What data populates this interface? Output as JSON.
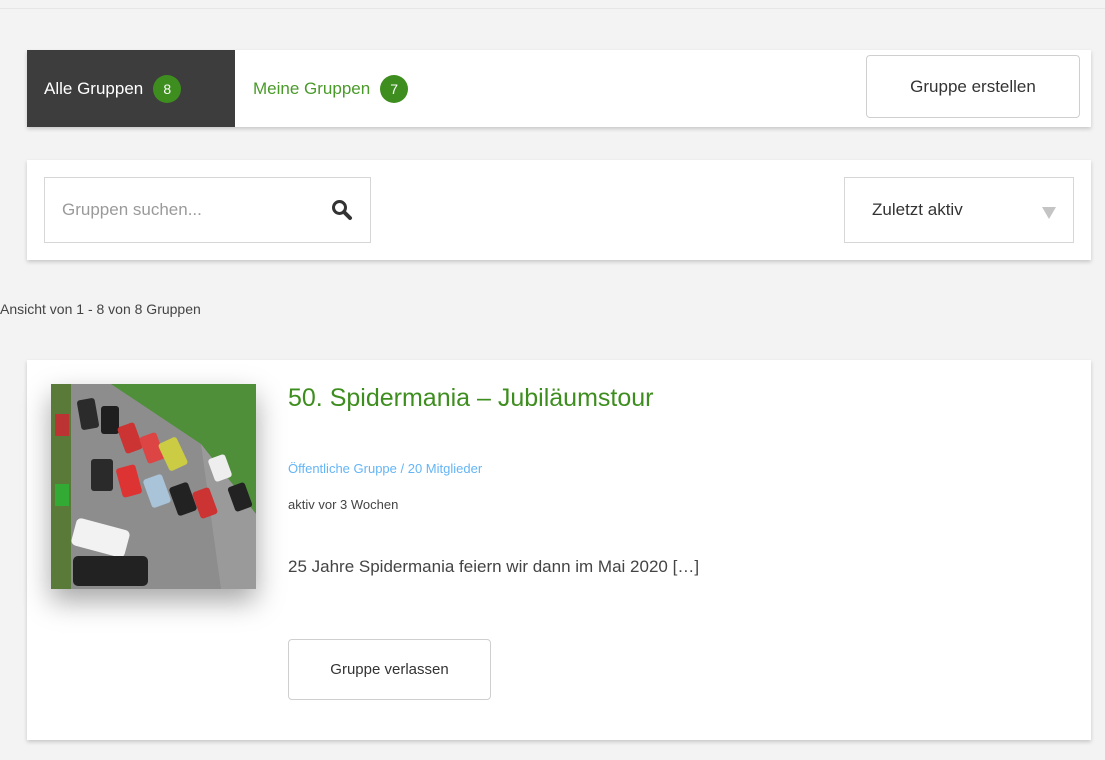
{
  "tabs": {
    "all": {
      "label": "Alle Gruppen",
      "count": "8"
    },
    "mine": {
      "label": "Meine Gruppen",
      "count": "7"
    }
  },
  "actions": {
    "create_group": "Gruppe erstellen"
  },
  "filter": {
    "search_placeholder": "Gruppen suchen...",
    "sort_selected": "Zuletzt aktiv"
  },
  "summary": "Ansicht von 1 - 8 von 8 Gruppen",
  "groups": [
    {
      "title": "50. Spidermania – Jubiläumstour",
      "meta": "Öffentliche Gruppe / 20 Mitglieder",
      "active": "aktiv vor 3 Wochen",
      "description": "25 Jahre Spidermania feiern wir dann im Mai 2020 […]",
      "button": "Gruppe verlassen"
    }
  ],
  "colors": {
    "accent": "#3e8e1f",
    "dark_tab": "#3d3d3d",
    "meta_link": "#64b5f6"
  }
}
